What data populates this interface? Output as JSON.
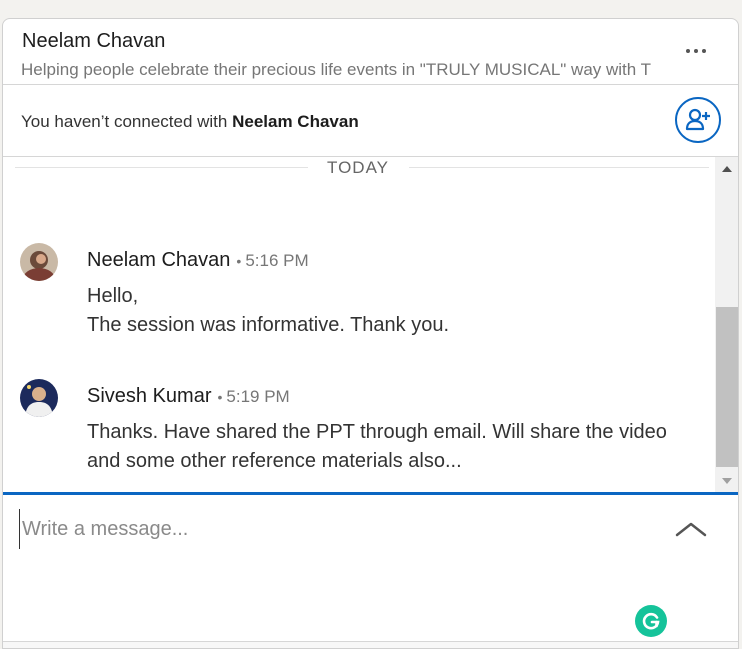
{
  "header": {
    "name": "Neelam Chavan",
    "headline": "Helping people celebrate their precious life events in \"TRULY MUSICAL\" way with T",
    "more_icon": "ellipsis-icon"
  },
  "connect_bar": {
    "prefix": "You haven’t connected with ",
    "name": "Neelam Chavan",
    "button_icon": "add-person-icon"
  },
  "thread": {
    "date_label": "TODAY",
    "messages": [
      {
        "sender": "Neelam Chavan",
        "time": "5:16 PM",
        "lines": [
          "Hello,",
          "The session was informative. Thank you."
        ]
      },
      {
        "sender": "Sivesh Kumar",
        "time": "5:19 PM",
        "lines": [
          "Thanks. Have shared the PPT through email. Will share the video",
          "and some other reference materials also..."
        ]
      }
    ]
  },
  "composer": {
    "placeholder": "Write a message...",
    "expand_icon": "chevron-up-icon",
    "grammarly_icon": "grammarly-icon"
  },
  "colors": {
    "accent": "#0a66c2",
    "grammarly": "#15c39a"
  }
}
